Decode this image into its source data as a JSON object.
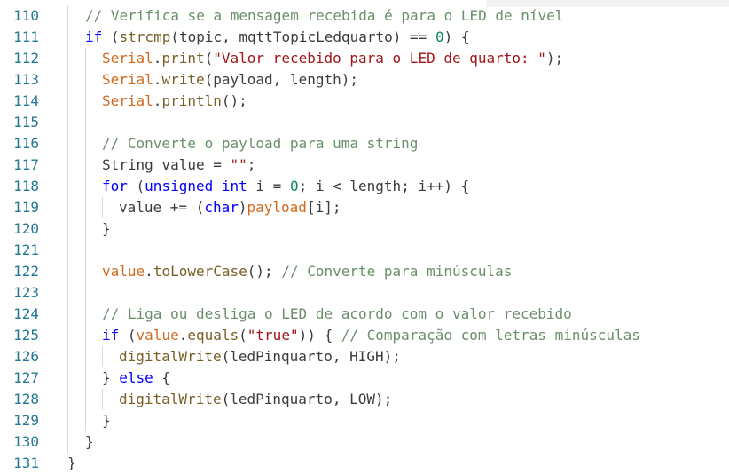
{
  "editor": {
    "colors": {
      "line_number": "#237893",
      "comment": "#6a8f6a",
      "keyword": "#0000ff",
      "function": "#795e26",
      "string": "#a31515",
      "object": "#d2691e",
      "number": "#098658",
      "plain": "#3b3b3b",
      "indent_guide": "#d9d9d9"
    },
    "lines": [
      {
        "num": "110",
        "indent": 1,
        "tokens": [
          {
            "t": "c",
            "v": "// Verifica se a mensagem recebida é para o LED de nível"
          }
        ]
      },
      {
        "num": "111",
        "indent": 1,
        "tokens": [
          {
            "t": "k",
            "v": "if"
          },
          {
            "t": "p",
            "v": " ("
          },
          {
            "t": "f",
            "v": "strcmp"
          },
          {
            "t": "p",
            "v": "(topic, mqttTopicLedquarto) == "
          },
          {
            "t": "n",
            "v": "0"
          },
          {
            "t": "p",
            "v": ") {"
          }
        ]
      },
      {
        "num": "112",
        "indent": 2,
        "tokens": [
          {
            "t": "v",
            "v": "Serial"
          },
          {
            "t": "p",
            "v": "."
          },
          {
            "t": "f",
            "v": "print"
          },
          {
            "t": "p",
            "v": "("
          },
          {
            "t": "s",
            "v": "\"Valor recebido para o LED de quarto: \""
          },
          {
            "t": "p",
            "v": ");"
          }
        ]
      },
      {
        "num": "113",
        "indent": 2,
        "tokens": [
          {
            "t": "v",
            "v": "Serial"
          },
          {
            "t": "p",
            "v": "."
          },
          {
            "t": "f",
            "v": "write"
          },
          {
            "t": "p",
            "v": "(payload, length);"
          }
        ]
      },
      {
        "num": "114",
        "indent": 2,
        "tokens": [
          {
            "t": "v",
            "v": "Serial"
          },
          {
            "t": "p",
            "v": "."
          },
          {
            "t": "f",
            "v": "println"
          },
          {
            "t": "p",
            "v": "();"
          }
        ]
      },
      {
        "num": "115",
        "indent": 2,
        "tokens": []
      },
      {
        "num": "116",
        "indent": 2,
        "tokens": [
          {
            "t": "c",
            "v": "// Converte o payload para uma string"
          }
        ]
      },
      {
        "num": "117",
        "indent": 2,
        "tokens": [
          {
            "t": "p",
            "v": "String value = "
          },
          {
            "t": "s",
            "v": "\"\""
          },
          {
            "t": "p",
            "v": ";"
          }
        ]
      },
      {
        "num": "118",
        "indent": 2,
        "tokens": [
          {
            "t": "k",
            "v": "for"
          },
          {
            "t": "p",
            "v": " ("
          },
          {
            "t": "k",
            "v": "unsigned"
          },
          {
            "t": "p",
            "v": " "
          },
          {
            "t": "k",
            "v": "int"
          },
          {
            "t": "p",
            "v": " i = "
          },
          {
            "t": "n",
            "v": "0"
          },
          {
            "t": "p",
            "v": "; i < length; i++) {"
          }
        ]
      },
      {
        "num": "119",
        "indent": 3,
        "tokens": [
          {
            "t": "p",
            "v": "value += ("
          },
          {
            "t": "k",
            "v": "char"
          },
          {
            "t": "p",
            "v": ")"
          },
          {
            "t": "v",
            "v": "payload"
          },
          {
            "t": "p",
            "v": "[i];"
          }
        ]
      },
      {
        "num": "120",
        "indent": 2,
        "tokens": [
          {
            "t": "p",
            "v": "}"
          }
        ]
      },
      {
        "num": "121",
        "indent": 2,
        "tokens": []
      },
      {
        "num": "122",
        "indent": 2,
        "tokens": [
          {
            "t": "v",
            "v": "value"
          },
          {
            "t": "p",
            "v": "."
          },
          {
            "t": "f",
            "v": "toLowerCase"
          },
          {
            "t": "p",
            "v": "(); "
          },
          {
            "t": "c",
            "v": "// Converte para minúsculas"
          }
        ]
      },
      {
        "num": "123",
        "indent": 2,
        "tokens": []
      },
      {
        "num": "124",
        "indent": 2,
        "tokens": [
          {
            "t": "c",
            "v": "// Liga ou desliga o LED de acordo com o valor recebido"
          }
        ]
      },
      {
        "num": "125",
        "indent": 2,
        "tokens": [
          {
            "t": "k",
            "v": "if"
          },
          {
            "t": "p",
            "v": " ("
          },
          {
            "t": "v",
            "v": "value"
          },
          {
            "t": "p",
            "v": "."
          },
          {
            "t": "f",
            "v": "equals"
          },
          {
            "t": "p",
            "v": "("
          },
          {
            "t": "s",
            "v": "\"true\""
          },
          {
            "t": "p",
            "v": ")) { "
          },
          {
            "t": "c",
            "v": "// Comparação com letras minúsculas"
          }
        ]
      },
      {
        "num": "126",
        "indent": 3,
        "tokens": [
          {
            "t": "f",
            "v": "digitalWrite"
          },
          {
            "t": "p",
            "v": "(ledPinquarto, HIGH);"
          }
        ]
      },
      {
        "num": "127",
        "indent": 2,
        "tokens": [
          {
            "t": "p",
            "v": "} "
          },
          {
            "t": "k",
            "v": "else"
          },
          {
            "t": "p",
            "v": " {"
          }
        ]
      },
      {
        "num": "128",
        "indent": 3,
        "tokens": [
          {
            "t": "f",
            "v": "digitalWrite"
          },
          {
            "t": "p",
            "v": "(ledPinquarto, LOW);"
          }
        ]
      },
      {
        "num": "129",
        "indent": 2,
        "tokens": [
          {
            "t": "p",
            "v": "}"
          }
        ]
      },
      {
        "num": "130",
        "indent": 1,
        "tokens": [
          {
            "t": "p",
            "v": "}"
          }
        ]
      },
      {
        "num": "131",
        "indent": 0,
        "tokens": [
          {
            "t": "p",
            "v": "}"
          }
        ]
      }
    ]
  }
}
